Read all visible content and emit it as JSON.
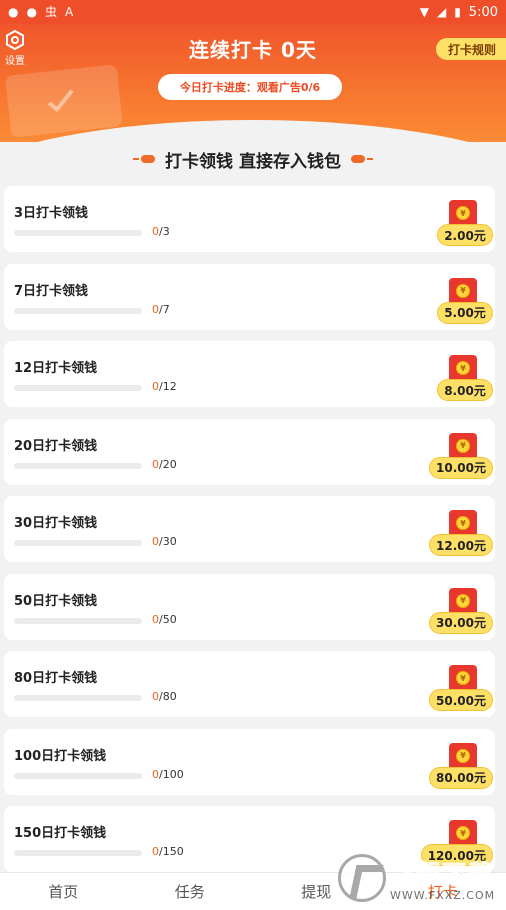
{
  "status_bar": {
    "time": "5:00",
    "glyph_1": "虫",
    "glyph_2": "A"
  },
  "header": {
    "settings_label": "设置",
    "title": "连续打卡 0天",
    "rules_label": "打卡规则",
    "today_progress": "今日打卡进度：观看广告0/6"
  },
  "section_title": "打卡领钱 直接存入钱包",
  "rewards": [
    {
      "name": "3日打卡领钱",
      "current": "0",
      "target": "/3",
      "amount": "2.00元",
      "progress": 0
    },
    {
      "name": "7日打卡领钱",
      "current": "0",
      "target": "/7",
      "amount": "5.00元",
      "progress": 0
    },
    {
      "name": "12日打卡领钱",
      "current": "0",
      "target": "/12",
      "amount": "8.00元",
      "progress": 0
    },
    {
      "name": "20日打卡领钱",
      "current": "0",
      "target": "/20",
      "amount": "10.00元",
      "progress": 0
    },
    {
      "name": "30日打卡领钱",
      "current": "0",
      "target": "/30",
      "amount": "12.00元",
      "progress": 0
    },
    {
      "name": "50日打卡领钱",
      "current": "0",
      "target": "/50",
      "amount": "30.00元",
      "progress": 0
    },
    {
      "name": "80日打卡领钱",
      "current": "0",
      "target": "/80",
      "amount": "50.00元",
      "progress": 0
    },
    {
      "name": "100日打卡领钱",
      "current": "0",
      "target": "/100",
      "amount": "80.00元",
      "progress": 0
    },
    {
      "name": "150日打卡领钱",
      "current": "0",
      "target": "/150",
      "amount": "120.00元",
      "progress": 0
    }
  ],
  "coin_symbol": "¥",
  "tabs": [
    {
      "label": "首页",
      "active": false
    },
    {
      "label": "任务",
      "active": false
    },
    {
      "label": "提现",
      "active": false
    },
    {
      "label": "打卡",
      "active": true
    }
  ],
  "watermark": {
    "cn": "飞翔下载",
    "en": "WWW.FXXZ.COM"
  },
  "colors": {
    "primary": "#f0562c",
    "accent_yellow": "#ffe067",
    "progress_text": "#f0641e"
  }
}
